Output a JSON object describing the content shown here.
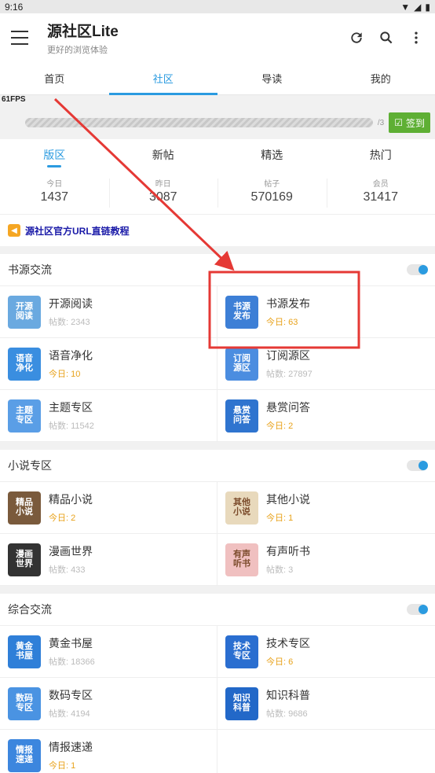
{
  "status_bar": {
    "time": "9:16"
  },
  "app": {
    "title": "源社区Lite",
    "subtitle": "更好的浏览体验"
  },
  "main_tabs": [
    "首页",
    "社区",
    "导读",
    "我的"
  ],
  "fps": "61FPS",
  "progress": {
    "count": "/3",
    "sign_label": "签到"
  },
  "sub_tabs": [
    "版区",
    "新帖",
    "精选",
    "热门"
  ],
  "stats": [
    {
      "label": "今日",
      "value": "1437"
    },
    {
      "label": "昨日",
      "value": "3087"
    },
    {
      "label": "帖子",
      "value": "570169"
    },
    {
      "label": "会员",
      "value": "31417"
    }
  ],
  "notice": "源社区官方URL直链教程",
  "sections": [
    {
      "title": "书源交流",
      "items": [
        {
          "name": "开源阅读",
          "meta": "帖数: 2343",
          "thumb": "开源\n阅读",
          "color": "#6aa9e0"
        },
        {
          "name": "书源发布",
          "meta": "今日: 63",
          "thumb": "书源\n发布",
          "color": "#3d7fd6"
        },
        {
          "name": "语音净化",
          "meta": "今日: 10",
          "thumb": "语音\n净化",
          "color": "#3a8ee0"
        },
        {
          "name": "订阅源区",
          "meta": "帖数: 27897",
          "thumb": "订阅\n源区",
          "color": "#4b8de0"
        },
        {
          "name": "主题专区",
          "meta": "帖数: 11542",
          "thumb": "主题\n专区",
          "color": "#5a9ee6"
        },
        {
          "name": "悬赏问答",
          "meta": "今日: 2",
          "thumb": "悬赏\n问答",
          "color": "#2f74cf"
        }
      ]
    },
    {
      "title": "小说专区",
      "items": [
        {
          "name": "精品小说",
          "meta": "今日: 2",
          "thumb": "精品\n小说",
          "color": "#7a5a3c"
        },
        {
          "name": "其他小说",
          "meta": "今日: 1",
          "thumb": "其他\n小说",
          "color": "#e8d9bc"
        },
        {
          "name": "漫画世界",
          "meta": "帖数: 433",
          "thumb": "漫画\n世界",
          "color": "#333333"
        },
        {
          "name": "有声听书",
          "meta": "帖数: 3",
          "thumb": "有声\n听书",
          "color": "#f0c0c0"
        }
      ]
    },
    {
      "title": "综合交流",
      "items": [
        {
          "name": "黄金书屋",
          "meta": "帖数: 18366",
          "thumb": "黄金\n书屋",
          "color": "#2f7fd8"
        },
        {
          "name": "技术专区",
          "meta": "今日: 6",
          "thumb": "技术\n专区",
          "color": "#2a6ed0"
        },
        {
          "name": "数码专区",
          "meta": "帖数: 4194",
          "thumb": "数码\n专区",
          "color": "#4a93e2"
        },
        {
          "name": "知识科普",
          "meta": "帖数: 9686",
          "thumb": "知识\n科普",
          "color": "#2268c8"
        },
        {
          "name": "情报速递",
          "meta": "今日: 1",
          "thumb": "情报\n速递",
          "color": "#3c86de"
        }
      ]
    }
  ],
  "colors": {
    "accent": "#2b9be0",
    "annotation": "#e53935",
    "sign": "#5eaf34",
    "today": "#e8a21a"
  }
}
